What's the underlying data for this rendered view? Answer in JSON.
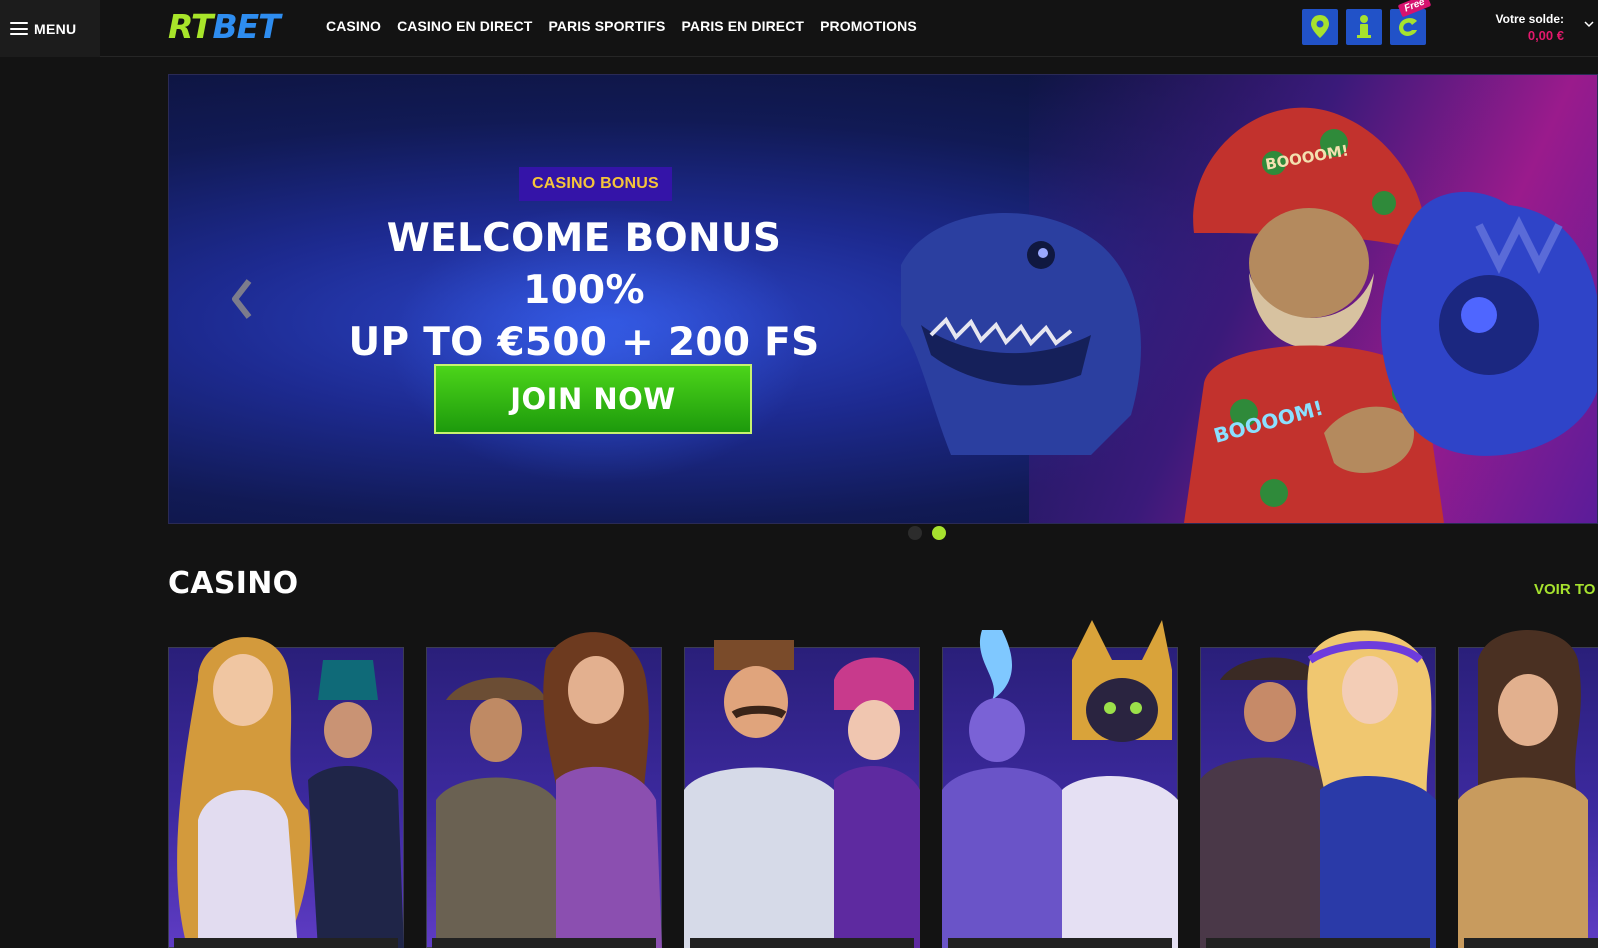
{
  "header": {
    "menu_label": "MENU",
    "logo_rt": "RT",
    "logo_bet": "BET",
    "nav": [
      "CASINO",
      "CASINO EN DIRECT",
      "PARIS SPORTIFS",
      "PARIS EN DIRECT",
      "PROMOTIONS"
    ],
    "free_badge": "Free",
    "balance_label": "Votre solde:",
    "balance_value": "0,00 €"
  },
  "hero": {
    "tag": "CASINO BONUS",
    "title_line1": "WELCOME BONUS 100%",
    "title_line2": "UP TO €500 + 200 FS",
    "cta": "JOIN NOW",
    "slide_count": 2,
    "active_slide": 2,
    "graphic_text_1": "BOOOOM!",
    "graphic_text_2": "BOOOOM!"
  },
  "casino_section": {
    "title": "CASINO",
    "view_all": "VOIR TO",
    "game_count": 6
  },
  "colors": {
    "accent_green": "#a6e22e",
    "brand_blue": "#2152c8",
    "balance_pink": "#e3186c",
    "tag_yellow": "#f6c43a"
  },
  "icons": [
    "menu-icon",
    "map-pin-icon",
    "person-icon",
    "bonus-coin-icon",
    "chevron-down-icon",
    "chevron-left-icon"
  ]
}
